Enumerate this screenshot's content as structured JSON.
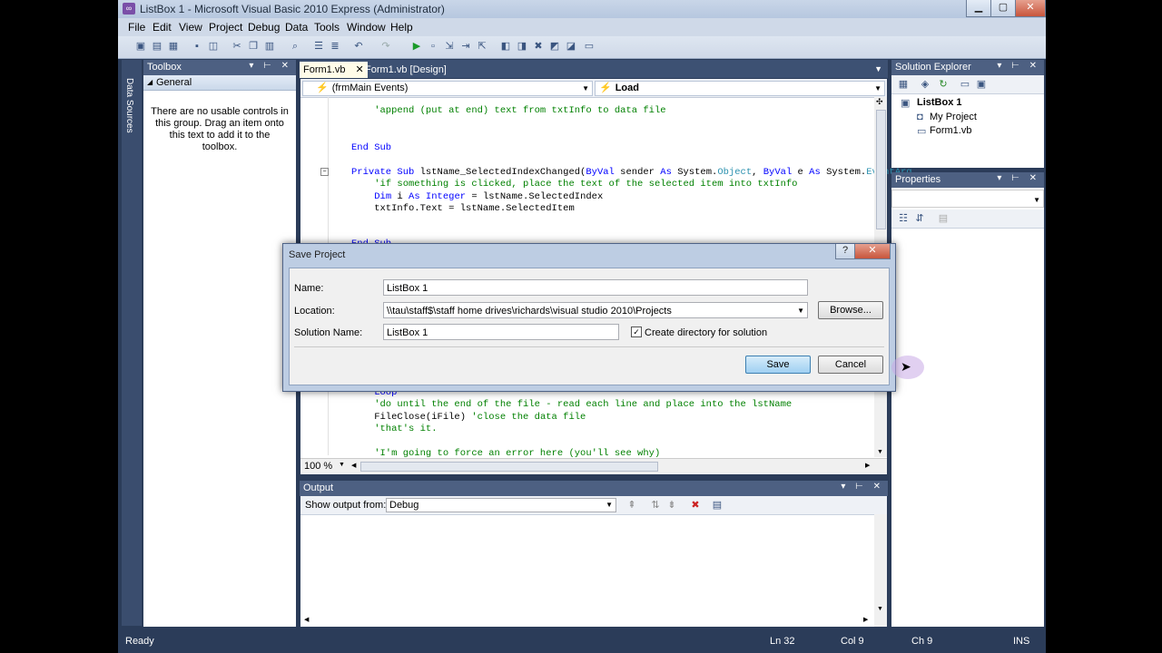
{
  "window": {
    "title": "ListBox 1 - Microsoft Visual Basic 2010 Express (Administrator)"
  },
  "menu": [
    "File",
    "Edit",
    "View",
    "Project",
    "Debug",
    "Data",
    "Tools",
    "Window",
    "Help"
  ],
  "sidebar_strip": {
    "label": "Data Sources"
  },
  "toolbox": {
    "title": "Toolbox",
    "group": "General",
    "message": "There are no usable controls in this group. Drag an item onto this text to add it to the toolbox."
  },
  "tabs": [
    {
      "label": "Form1.vb",
      "close": "✕"
    },
    {
      "label": "Form1.vb [Design]"
    }
  ],
  "editor": {
    "left_dropdown": "(frmMain Events)",
    "right_dropdown": "Load",
    "zoom": "100 %",
    "lines_top": [
      {
        "text": "    'append (put at end) text from txtInfo to data file"
      },
      {
        "text": "End Sub"
      },
      {
        "text": "Private Sub lstName_SelectedIndexChanged(ByVal sender As System.Object, ByVal e As System.EventArg"
      },
      {
        "text": "    'if something is clicked, place the text of the selected item into txtInfo"
      },
      {
        "text": "    Dim i As Integer = lstName.SelectedIndex"
      },
      {
        "text": "    txtInfo.Text = lstName.SelectedItem"
      },
      {
        "text": "End Sub"
      }
    ],
    "lines_bottom": [
      {
        "text": "    Loop"
      },
      {
        "text": "    'do until the end of the file - read each line and place into the lstName"
      },
      {
        "text": "    FileClose(iFile) 'close the data file"
      },
      {
        "text": "    'that's it."
      },
      {
        "text": "    'I'm going to force an error here (you'll see why)"
      }
    ]
  },
  "dialog": {
    "title": "Save Project",
    "help": "?",
    "close": "✕",
    "name_label": "Name:",
    "name_value": "ListBox 1",
    "location_label": "Location:",
    "location_value": "\\\\tau\\staff$\\staff home drives\\richards\\visual studio 2010\\Projects",
    "browse": "Browse...",
    "solution_label": "Solution Name:",
    "solution_value": "ListBox 1",
    "create_dir": "Create directory for solution",
    "create_dir_checked": true,
    "save": "Save",
    "cancel": "Cancel"
  },
  "output": {
    "title": "Output",
    "show_from_label": "Show output from:",
    "show_from_value": "Debug"
  },
  "solution_explorer": {
    "title": "Solution Explorer",
    "project": "ListBox 1",
    "items": [
      "My Project",
      "Form1.vb"
    ]
  },
  "properties": {
    "title": "Properties"
  },
  "status": {
    "ready": "Ready",
    "ln": "Ln 32",
    "col": "Col 9",
    "ch": "Ch 9",
    "ins": "INS"
  },
  "colors": {
    "chrome": "#2b3c59",
    "panel_header": "#4d6082",
    "accent": "#5f8de0"
  }
}
